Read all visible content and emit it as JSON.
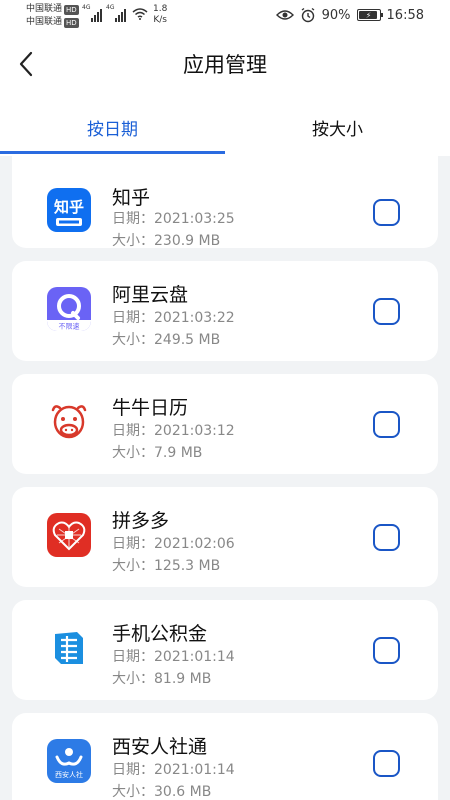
{
  "status_bar": {
    "carrier1": "中国联通",
    "carrier2": "中国联通",
    "hd_badge": "HD",
    "network1": "4G",
    "network2": "4G",
    "speed_value": "1.8",
    "speed_unit": "K/s",
    "battery": "90%",
    "time": "16:58",
    "icons": [
      "signal-icon",
      "wifi-icon",
      "eye-icon",
      "alarm-icon",
      "battery-icon"
    ]
  },
  "header": {
    "title": "应用管理",
    "back_icon": "chevron-left-icon"
  },
  "tabs": [
    {
      "label": "按日期",
      "active": true
    },
    {
      "label": "按大小",
      "active": false
    }
  ],
  "apps": [
    {
      "name": "知乎",
      "date": "日期：2021:03:25",
      "size": "大小：230.9 MB",
      "icon": "zhihu-icon",
      "icon_color": "#0f6ff0",
      "icon_text": "知乎"
    },
    {
      "name": "阿里云盘",
      "date": "日期：2021:03:22",
      "size": "大小：249.5 MB",
      "icon": "aliyun-drive-icon",
      "icon_color": "#6a63f5",
      "icon_text": "不限速"
    },
    {
      "name": "牛牛日历",
      "date": "日期：2021:03:12",
      "size": "大小：7.9 MB",
      "icon": "cow-icon",
      "icon_color": "#d8392b"
    },
    {
      "name": "拼多多",
      "date": "日期：2021:02:06",
      "size": "大小：125.3 MB",
      "icon": "pinduoduo-icon",
      "icon_color": "#e02e24"
    },
    {
      "name": "手机公积金",
      "date": "日期：2021:01:14",
      "size": "大小：81.9 MB",
      "icon": "housing-fund-icon",
      "icon_color": "#1b8fe0"
    },
    {
      "name": "西安人社通",
      "date": "日期：2021:01:14",
      "size": "大小：30.6 MB",
      "icon": "xian-social-icon",
      "icon_color": "#2d7be6",
      "icon_text": "西安人社"
    }
  ],
  "colors": {
    "accent": "#1a5fd6",
    "checkbox_border": "#1a56c6",
    "background": "#f1f3f5"
  }
}
